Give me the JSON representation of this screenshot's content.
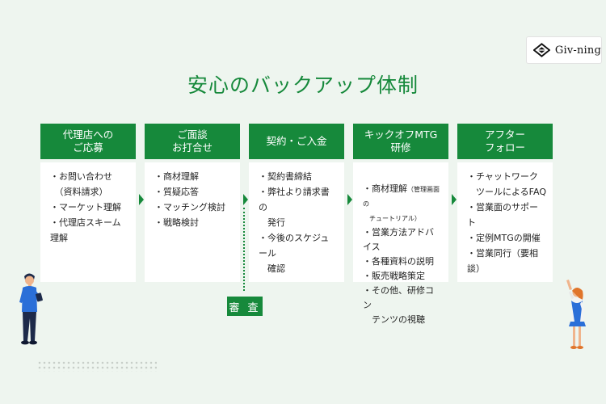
{
  "logo": {
    "text": "Giv-ning",
    "icon": "logo-icon"
  },
  "title": "安心のバックアップ体制",
  "colors": {
    "accent": "#16893b",
    "background": "#eef5ef"
  },
  "steps": [
    {
      "header": "代理店への\nご応募",
      "items": [
        "・お問い合わせ\n　（資料請求）",
        "・マーケット理解",
        "・代理店スキーム理解"
      ]
    },
    {
      "header": "ご面談\nお打合せ",
      "items": [
        "・商材理解",
        "・質疑応答",
        "・マッチング検討",
        "・戦略検討"
      ]
    },
    {
      "header": "契約・ご入金",
      "items": [
        "・契約書締結",
        "・弊社より請求書の\n　発行",
        "・今後のスケジュール\n　確認"
      ]
    },
    {
      "header": "キックオフMTG\n研修",
      "items": [
        "・商材理解",
        "・営業方法アドバイス",
        "・各種資料の説明",
        "・販売戦略策定",
        "・その他、研修コン\n　テンツの視聴"
      ],
      "item0_note": "（管理画面の\n　チュートリアル）"
    },
    {
      "header": "アフター\nフォロー",
      "items": [
        "・チャットワーク\n　ツールによるFAQ",
        "・営業面のサポート",
        "・定例MTGの開催",
        "・営業同行（要相談）"
      ]
    }
  ],
  "review_label": "審 査"
}
